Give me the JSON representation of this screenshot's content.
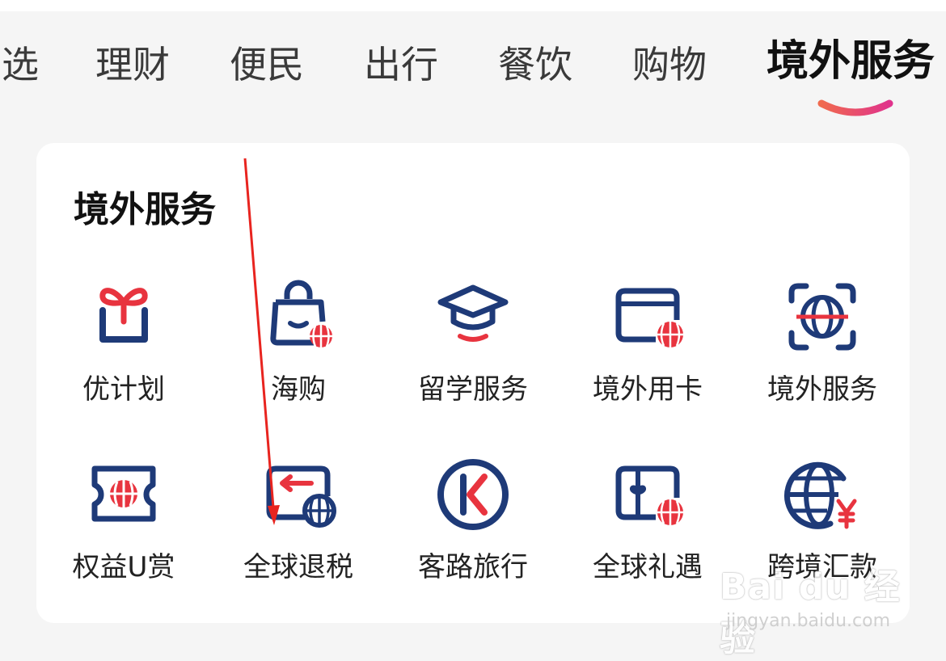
{
  "tabs": [
    {
      "label": "选"
    },
    {
      "label": "理财"
    },
    {
      "label": "便民"
    },
    {
      "label": "出行"
    },
    {
      "label": "餐饮"
    },
    {
      "label": "购物"
    },
    {
      "label": "境外服务",
      "active": true
    }
  ],
  "section": {
    "title": "境外服务",
    "items": [
      {
        "label": "优计划",
        "icon": "gift-icon"
      },
      {
        "label": "海购",
        "icon": "shopping-bag-globe-icon"
      },
      {
        "label": "留学服务",
        "icon": "graduation-cap-icon"
      },
      {
        "label": "境外用卡",
        "icon": "card-globe-icon"
      },
      {
        "label": "境外服务",
        "icon": "globe-scan-icon"
      },
      {
        "label": "权益U赏",
        "icon": "ticket-globe-icon"
      },
      {
        "label": "全球退税",
        "icon": "card-arrow-globe-icon"
      },
      {
        "label": "客路旅行",
        "icon": "klook-logo-icon"
      },
      {
        "label": "全球礼遇",
        "icon": "gift-card-globe-icon"
      },
      {
        "label": "跨境汇款",
        "icon": "globe-yuan-icon"
      }
    ]
  },
  "watermark": {
    "main": "Bai du 经验",
    "sub": "jingyan.baidu.com"
  },
  "colors": {
    "navy": "#1e3a78",
    "red": "#e8343f",
    "accent_gradient": [
      "#f06a4e",
      "#e0338c"
    ]
  }
}
